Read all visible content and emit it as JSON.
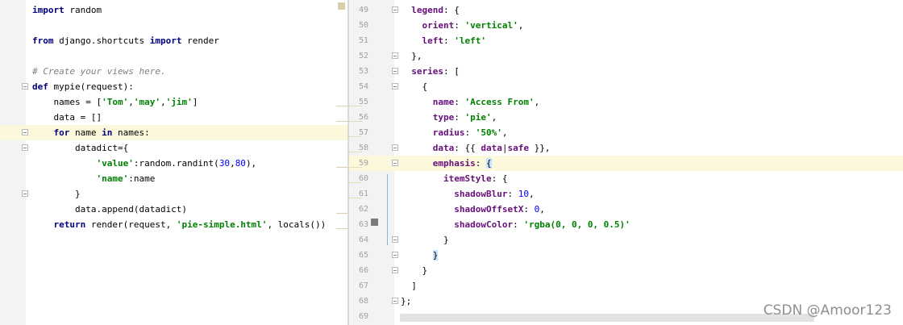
{
  "left_code": [
    {
      "segments": [
        {
          "t": "import",
          "c": "kw"
        },
        {
          "t": " random"
        }
      ]
    },
    {
      "segments": []
    },
    {
      "segments": [
        {
          "t": "from",
          "c": "kw"
        },
        {
          "t": " django.shortcuts "
        },
        {
          "t": "import",
          "c": "kw"
        },
        {
          "t": " render"
        }
      ]
    },
    {
      "segments": []
    },
    {
      "segments": [
        {
          "t": "# Create your views here.",
          "c": "cmt"
        }
      ]
    },
    {
      "segments": [
        {
          "t": "def",
          "c": "kw"
        },
        {
          "t": " mypie(request):"
        }
      ]
    },
    {
      "segments": [
        {
          "t": "    names = ["
        },
        {
          "t": "'Tom'",
          "c": "str"
        },
        {
          "t": ","
        },
        {
          "t": "'may'",
          "c": "str"
        },
        {
          "t": ","
        },
        {
          "t": "'jim'",
          "c": "str"
        },
        {
          "t": "]"
        }
      ]
    },
    {
      "segments": [
        {
          "t": "    data = []"
        }
      ]
    },
    {
      "segments": [
        {
          "t": "    "
        },
        {
          "t": "for",
          "c": "kw"
        },
        {
          "t": " name "
        },
        {
          "t": "in",
          "c": "kw"
        },
        {
          "t": " names:"
        }
      ]
    },
    {
      "segments": [
        {
          "t": "        datadict={"
        }
      ]
    },
    {
      "segments": [
        {
          "t": "            "
        },
        {
          "t": "'value'",
          "c": "str"
        },
        {
          "t": ":random.randint("
        },
        {
          "t": "30",
          "c": "num"
        },
        {
          "t": ","
        },
        {
          "t": "80",
          "c": "num"
        },
        {
          "t": "),"
        }
      ]
    },
    {
      "segments": [
        {
          "t": "            "
        },
        {
          "t": "'name'",
          "c": "str"
        },
        {
          "t": ":name"
        }
      ]
    },
    {
      "segments": [
        {
          "t": "        }"
        }
      ]
    },
    {
      "segments": [
        {
          "t": "        data.append(datadict)"
        }
      ]
    },
    {
      "segments": [
        {
          "t": "    "
        },
        {
          "t": "return",
          "c": "kw"
        },
        {
          "t": " render(request, "
        },
        {
          "t": "'pie-simple.html'",
          "c": "str"
        },
        {
          "t": ", locals())"
        }
      ]
    }
  ],
  "right_code": [
    {
      "num": "49",
      "segments": [
        {
          "t": "  "
        },
        {
          "t": "legend",
          "c": "prop"
        },
        {
          "t": ": {"
        }
      ]
    },
    {
      "num": "50",
      "segments": [
        {
          "t": "    "
        },
        {
          "t": "orient",
          "c": "prop"
        },
        {
          "t": ": "
        },
        {
          "t": "'vertical'",
          "c": "str"
        },
        {
          "t": ","
        }
      ]
    },
    {
      "num": "51",
      "segments": [
        {
          "t": "    "
        },
        {
          "t": "left",
          "c": "prop"
        },
        {
          "t": ": "
        },
        {
          "t": "'left'",
          "c": "str"
        }
      ]
    },
    {
      "num": "52",
      "segments": [
        {
          "t": "  },"
        }
      ]
    },
    {
      "num": "53",
      "segments": [
        {
          "t": "  "
        },
        {
          "t": "series",
          "c": "prop"
        },
        {
          "t": ": ["
        }
      ]
    },
    {
      "num": "54",
      "segments": [
        {
          "t": "    {"
        }
      ]
    },
    {
      "num": "55",
      "segments": [
        {
          "t": "      "
        },
        {
          "t": "name",
          "c": "prop"
        },
        {
          "t": ": "
        },
        {
          "t": "'Access From'",
          "c": "str"
        },
        {
          "t": ","
        }
      ]
    },
    {
      "num": "56",
      "segments": [
        {
          "t": "      "
        },
        {
          "t": "type",
          "c": "prop"
        },
        {
          "t": ": "
        },
        {
          "t": "'pie'",
          "c": "str"
        },
        {
          "t": ","
        }
      ]
    },
    {
      "num": "57",
      "segments": [
        {
          "t": "      "
        },
        {
          "t": "radius",
          "c": "prop"
        },
        {
          "t": ": "
        },
        {
          "t": "'50%'",
          "c": "str"
        },
        {
          "t": ","
        }
      ]
    },
    {
      "num": "58",
      "segments": [
        {
          "t": "      "
        },
        {
          "t": "data",
          "c": "prop"
        },
        {
          "t": ": {{ "
        },
        {
          "t": "data",
          "c": "prop"
        },
        {
          "t": "|"
        },
        {
          "t": "safe",
          "c": "prop"
        },
        {
          "t": " }},"
        }
      ]
    },
    {
      "num": "59",
      "segments": [
        {
          "t": "      "
        },
        {
          "t": "emphasis",
          "c": "prop"
        },
        {
          "t": ": "
        },
        {
          "t": "{",
          "c": "bm"
        }
      ]
    },
    {
      "num": "60",
      "segments": [
        {
          "t": "        "
        },
        {
          "t": "itemStyle",
          "c": "prop"
        },
        {
          "t": ": {"
        }
      ]
    },
    {
      "num": "61",
      "segments": [
        {
          "t": "          "
        },
        {
          "t": "shadowBlur",
          "c": "prop"
        },
        {
          "t": ": "
        },
        {
          "t": "10",
          "c": "num"
        },
        {
          "t": ","
        }
      ]
    },
    {
      "num": "62",
      "segments": [
        {
          "t": "          "
        },
        {
          "t": "shadowOffsetX",
          "c": "prop"
        },
        {
          "t": ": "
        },
        {
          "t": "0",
          "c": "num"
        },
        {
          "t": ","
        }
      ]
    },
    {
      "num": "63",
      "segments": [
        {
          "t": "          "
        },
        {
          "t": "shadowColor",
          "c": "prop"
        },
        {
          "t": ": "
        },
        {
          "t": "'rgba(0, 0, 0, 0.5)'",
          "c": "str"
        }
      ]
    },
    {
      "num": "64",
      "segments": [
        {
          "t": "        }"
        }
      ]
    },
    {
      "num": "65",
      "segments": [
        {
          "t": "      "
        },
        {
          "t": "}",
          "c": "bm"
        }
      ]
    },
    {
      "num": "66",
      "segments": [
        {
          "t": "    }"
        }
      ]
    },
    {
      "num": "67",
      "segments": [
        {
          "t": "  ]"
        }
      ]
    },
    {
      "num": "68",
      "segments": [
        {
          "t": "};"
        }
      ]
    },
    {
      "num": "69",
      "segments": []
    }
  ],
  "watermark": "CSDN @Amoor123",
  "colors": {
    "highlight": "#fbf8dc",
    "keyword": "#000080",
    "string": "#008000",
    "property": "#660e7a",
    "number": "#0000ff",
    "comment": "#808080"
  }
}
